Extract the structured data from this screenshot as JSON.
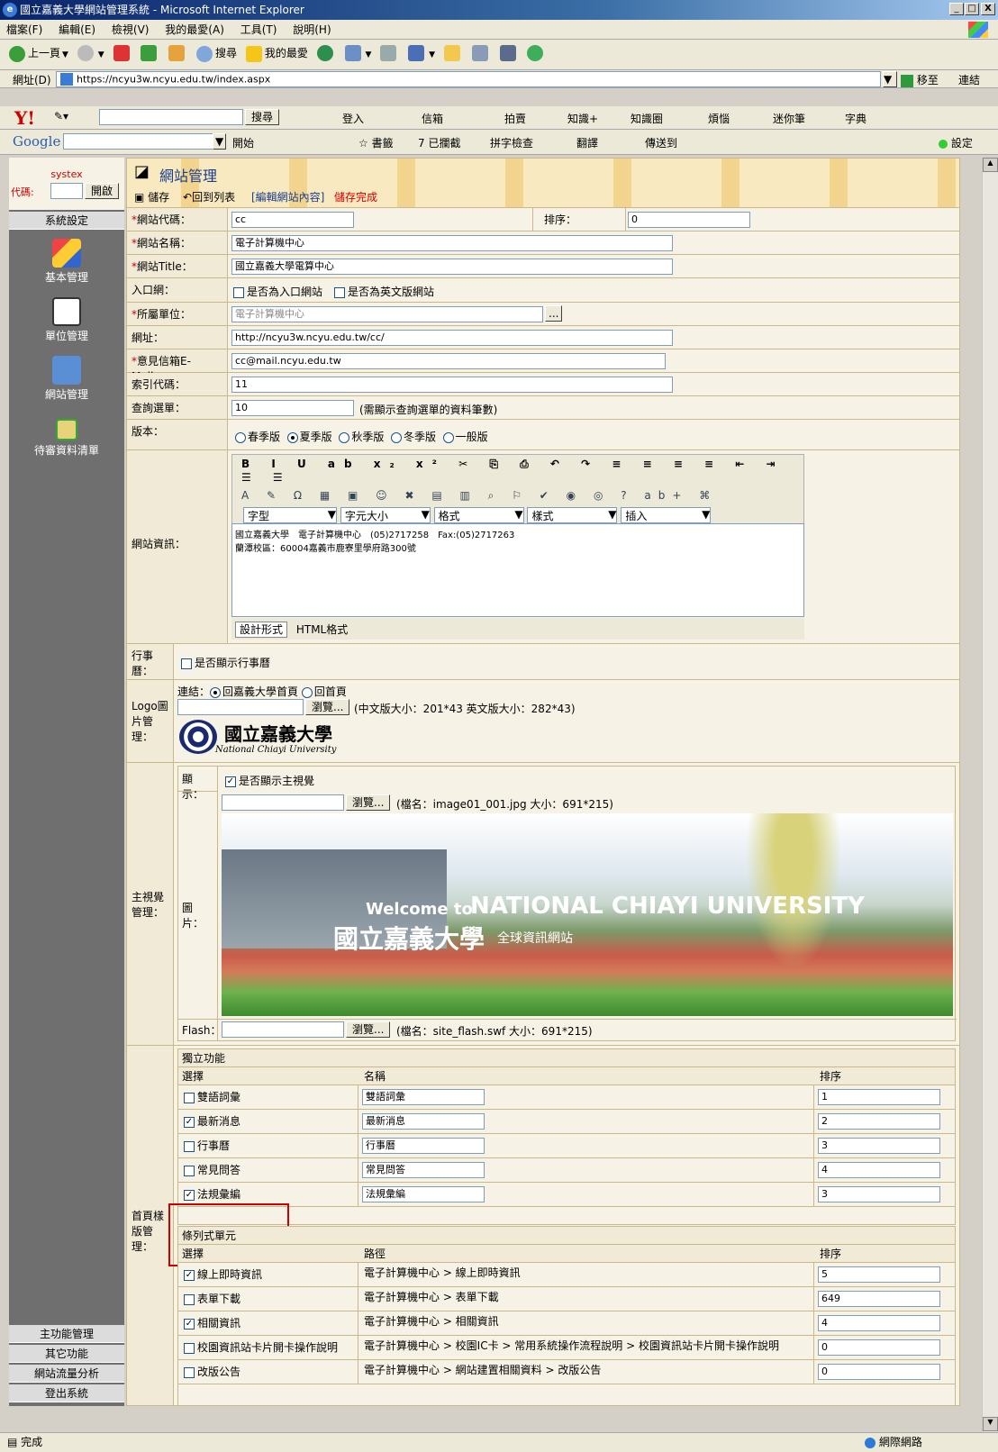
{
  "window": {
    "title": "國立嘉義大學網站管理系統 - Microsoft Internet Explorer",
    "min": "_",
    "max": "□",
    "close": "X"
  },
  "menu": [
    "檔案(F)",
    "編輯(E)",
    "檢視(V)",
    "我的最愛(A)",
    "工具(T)",
    "說明(H)"
  ],
  "toolbar": {
    "back": "上一頁",
    "search": "搜尋",
    "favorites": "我的最愛"
  },
  "address": {
    "label": "網址(D)",
    "url": "https://ncyu3w.ncyu.edu.tw/index.aspx",
    "go": "移至",
    "links": "連結"
  },
  "yahoo": {
    "search_btn": "搜尋",
    "signin": "登入",
    "items": [
      "信箱",
      "拍賣",
      "知識+",
      "知識圈",
      "煩惱",
      "迷你筆",
      "字典"
    ]
  },
  "google": {
    "open": "開始",
    "bookmarks": "書籤",
    "blocked": "7 已攔截",
    "spell": "拼字檢查",
    "translate": "翻譯",
    "send": "傳送到",
    "settings": "設定"
  },
  "login": {
    "user": "systex",
    "code_label": "代碼:",
    "open_btn": "開啟"
  },
  "nav": {
    "header": "系統設定",
    "items": [
      "基本管理",
      "單位管理",
      "網站管理",
      "待審資料清單"
    ],
    "bottom": [
      "主功能管理",
      "其它功能",
      "網站流量分析",
      "登出系統"
    ]
  },
  "page": {
    "title": "網站管理",
    "save": "儲存",
    "back_list": "回到列表",
    "edit_content": "[編輯網站內容]",
    "saved": "儲存完成"
  },
  "form": {
    "site_code": {
      "label": "網站代碼：",
      "value": "cc"
    },
    "sort": {
      "label": "排序：",
      "value": "0"
    },
    "site_name": {
      "label": "網站名稱：",
      "value": "電子計算機中心"
    },
    "site_title": {
      "label": "網站Title：",
      "value": "國立嘉義大學電算中心"
    },
    "portal": {
      "label": "入口網：",
      "opt1": "是否為入口網站",
      "opt2": "是否為英文版網站"
    },
    "unit": {
      "label": "所屬單位：",
      "value": "電子計算機中心",
      "btn": "..."
    },
    "url": {
      "label": "網址：",
      "value": "http://ncyu3w.ncyu.edu.tw/cc/"
    },
    "email": {
      "label": "意見信箱E-Mail：",
      "value": "cc@mail.ncyu.edu.tw"
    },
    "index_code": {
      "label": "索引代碼：",
      "value": "11"
    },
    "query": {
      "label": "查詢選單：",
      "value": "10",
      "hint": "(需顯示查詢選單的資料筆數)"
    },
    "version": {
      "label": "版本：",
      "options": [
        "春季版",
        "夏季版",
        "秋季版",
        "冬季版",
        "一般版"
      ],
      "selected": 1
    },
    "info": {
      "label": "網站資訊：",
      "line1": "國立嘉義大學　電子計算機中心　(05)2717258　Fax:(05)2717263",
      "line2": "蘭潭校區：60004嘉義市鹿寮里學府路300號",
      "selects": [
        "字型",
        "字元大小",
        "格式",
        "樣式",
        "插入"
      ],
      "tab_design": "設計形式",
      "tab_html": "HTML格式"
    },
    "calendar": {
      "label": "行事曆：",
      "opt": "是否顯示行事曆"
    },
    "logo": {
      "label": "Logo圖片管理：",
      "link_label": "連結：",
      "link1": "回嘉義大學首頁",
      "link2": "回首頁",
      "browse": "瀏覽...",
      "hint": "(中文版大小：201*43 英文版大小：282*43)",
      "logo_cn": "國立嘉義大學",
      "logo_en": "National Chiayi University"
    },
    "visual": {
      "label": "主視覺管理：",
      "show_label": "顯示：",
      "show_opt": "是否顯示主視覺",
      "pic_label": "圖片：",
      "browse": "瀏覽...",
      "pic_hint": "(檔名：image01_001.jpg 大小：691*215)",
      "banner_welcome": "Welcome to",
      "banner_name": "NATIONAL CHIAYI UNIVERSITY",
      "banner_cn": "國立嘉義大學",
      "banner_sub": "全球資訊網站",
      "flash_label": "Flash：",
      "flash_hint": "(檔名：site_flash.swf 大小：691*215)"
    },
    "home": {
      "label": "首頁樣版管理：",
      "solo_title": "獨立功能",
      "col_select": "選擇",
      "col_name": "名稱",
      "col_sort": "排序",
      "solo": [
        {
          "name": "雙語詞彙",
          "checked": false,
          "sort": "1"
        },
        {
          "name": "最新消息",
          "checked": true,
          "sort": "2"
        },
        {
          "name": "行事曆",
          "checked": false,
          "sort": "3"
        },
        {
          "name": "常見問答",
          "checked": false,
          "sort": "4"
        },
        {
          "name": "法規彙編",
          "checked": true,
          "sort": "3"
        }
      ],
      "list_title": "條列式單元",
      "col_path": "路徑",
      "list": [
        {
          "name": "線上即時資訊",
          "checked": true,
          "path": "電子計算機中心 > 線上即時資訊",
          "sort": "5"
        },
        {
          "name": "表單下載",
          "checked": false,
          "path": "電子計算機中心 > 表單下載",
          "sort": "649"
        },
        {
          "name": "相關資訊",
          "checked": true,
          "path": "電子計算機中心 > 相關資訊",
          "sort": "4"
        },
        {
          "name": "校園資訊站卡片開卡操作說明",
          "checked": false,
          "path": "電子計算機中心 > 校園IC卡 > 常用系統操作流程說明 > 校園資訊站卡片開卡操作說明",
          "sort": "0"
        },
        {
          "name": "改版公告",
          "checked": false,
          "path": "電子計算機中心 > 網站建置相關資料 > 改版公告",
          "sort": "0"
        }
      ]
    }
  },
  "status": {
    "left": "完成",
    "zone": "網際網路"
  },
  "colors": {
    "accent": "#c00000",
    "titlebar": "#0a246a",
    "panel": "#f6f2e5",
    "nav": "#6f6f6f"
  }
}
